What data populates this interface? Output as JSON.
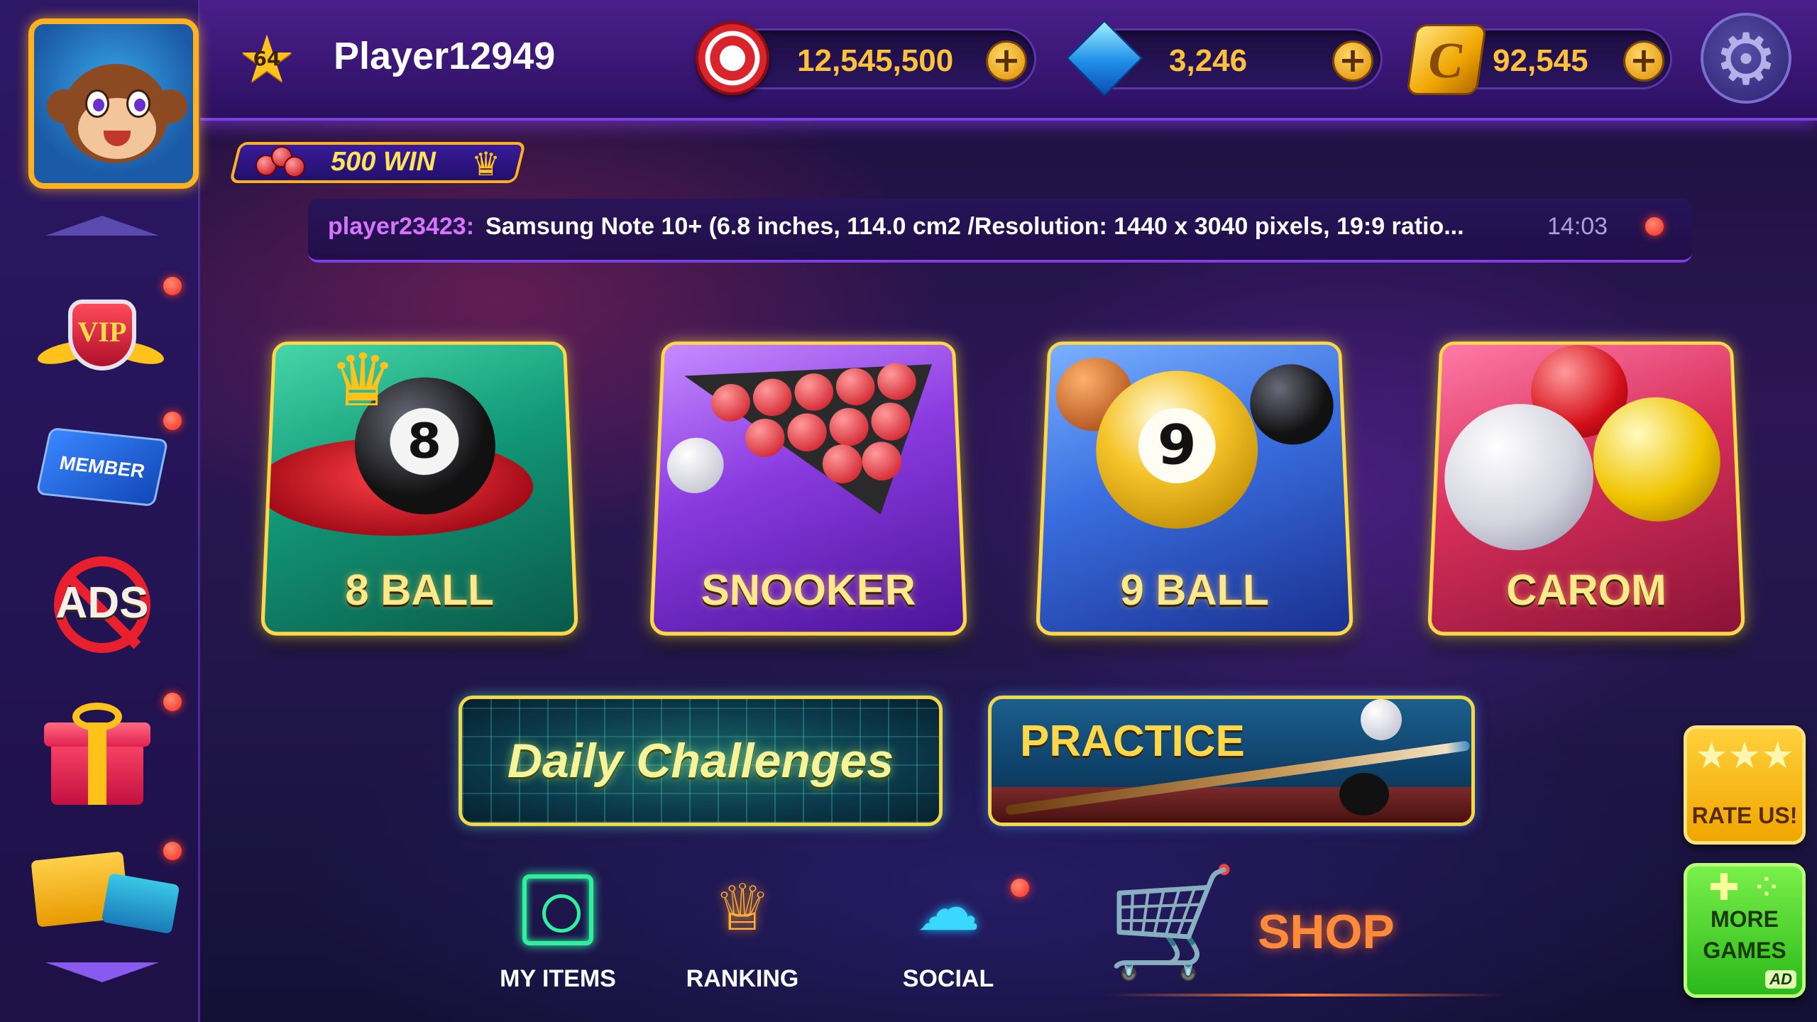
{
  "player": {
    "name": "Player12949",
    "level": "64",
    "win_badge": "500 WIN"
  },
  "currencies": {
    "chips": "12,545,500",
    "gems": "3,246",
    "coins": "92,545",
    "coin_symbol": "C"
  },
  "chat": {
    "user": "player23423:",
    "message": "Samsung Note 10+ (6.8 inches, 114.0 cm2 /Resolution: 1440 x 3040 pixels, 19:9 ratio...",
    "time": "14:03"
  },
  "sidebar": {
    "vip_label": "VIP",
    "member_label": "MEMBER",
    "noads_label": "ADS"
  },
  "modes": [
    {
      "label": "8 BALL"
    },
    {
      "label": "SNOOKER"
    },
    {
      "label": "9 BALL"
    },
    {
      "label": "CAROM"
    }
  ],
  "actions": {
    "daily": "Daily Challenges",
    "practice": "PRACTICE"
  },
  "nav": {
    "my_items": "MY ITEMS",
    "ranking": "RANKING",
    "social": "SOCIAL",
    "shop": "SHOP"
  },
  "side_buttons": {
    "rate": "RATE US!",
    "more_games": "MORE\nGAMES",
    "ad": "AD"
  },
  "colors": {
    "accent_gold": "#ffd84a",
    "notification_red": "#ff2a20",
    "card_8ball": "#129878",
    "card_snooker": "#8a3ae0",
    "card_9ball": "#3a6ee0",
    "card_carom": "#d8305a"
  }
}
